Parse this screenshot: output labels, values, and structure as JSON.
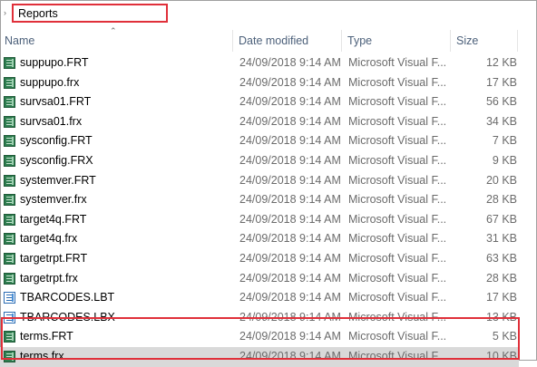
{
  "address": {
    "breadcrumb": "Reports"
  },
  "columns": {
    "name": "Name",
    "date": "Date modified",
    "type": "Type",
    "size": "Size"
  },
  "files": [
    {
      "name": "suppupo.FRT",
      "date": "24/09/2018 9:14 AM",
      "type": "Microsoft Visual F...",
      "size": "12 KB",
      "icon": "green-table-icon"
    },
    {
      "name": "suppupo.frx",
      "date": "24/09/2018 9:14 AM",
      "type": "Microsoft Visual F...",
      "size": "17 KB",
      "icon": "green-table-icon"
    },
    {
      "name": "survsa01.FRT",
      "date": "24/09/2018 9:14 AM",
      "type": "Microsoft Visual F...",
      "size": "56 KB",
      "icon": "green-table-icon"
    },
    {
      "name": "survsa01.frx",
      "date": "24/09/2018 9:14 AM",
      "type": "Microsoft Visual F...",
      "size": "34 KB",
      "icon": "green-table-icon"
    },
    {
      "name": "sysconfig.FRT",
      "date": "24/09/2018 9:14 AM",
      "type": "Microsoft Visual F...",
      "size": "7 KB",
      "icon": "green-table-icon"
    },
    {
      "name": "sysconfig.FRX",
      "date": "24/09/2018 9:14 AM",
      "type": "Microsoft Visual F...",
      "size": "9 KB",
      "icon": "green-table-icon"
    },
    {
      "name": "systemver.FRT",
      "date": "24/09/2018 9:14 AM",
      "type": "Microsoft Visual F...",
      "size": "20 KB",
      "icon": "green-table-icon"
    },
    {
      "name": "systemver.frx",
      "date": "24/09/2018 9:14 AM",
      "type": "Microsoft Visual F...",
      "size": "28 KB",
      "icon": "green-table-icon"
    },
    {
      "name": "target4q.FRT",
      "date": "24/09/2018 9:14 AM",
      "type": "Microsoft Visual F...",
      "size": "67 KB",
      "icon": "green-table-icon"
    },
    {
      "name": "target4q.frx",
      "date": "24/09/2018 9:14 AM",
      "type": "Microsoft Visual F...",
      "size": "31 KB",
      "icon": "green-table-icon"
    },
    {
      "name": "targetrpt.FRT",
      "date": "24/09/2018 9:14 AM",
      "type": "Microsoft Visual F...",
      "size": "63 KB",
      "icon": "green-table-icon"
    },
    {
      "name": "targetrpt.frx",
      "date": "24/09/2018 9:14 AM",
      "type": "Microsoft Visual F...",
      "size": "28 KB",
      "icon": "green-table-icon"
    },
    {
      "name": "TBARCODES.LBT",
      "date": "24/09/2018 9:14 AM",
      "type": "Microsoft Visual F...",
      "size": "17 KB",
      "icon": "blue-table-icon"
    },
    {
      "name": "TBARCODES.LBX",
      "date": "24/09/2018 9:14 AM",
      "type": "Microsoft Visual F...",
      "size": "13 KB",
      "icon": "blue-table-icon"
    },
    {
      "name": "terms.FRT",
      "date": "24/09/2018 9:14 AM",
      "type": "Microsoft Visual F...",
      "size": "5 KB",
      "icon": "green-table-icon"
    },
    {
      "name": "terms.frx",
      "date": "24/09/2018 9:14 AM",
      "type": "Microsoft Visual F...",
      "size": "10 KB",
      "icon": "green-table-icon",
      "selected": true
    }
  ],
  "colors": {
    "highlight": "#e0303a",
    "selection": "#d9d9d9",
    "header_text": "#4c607a"
  }
}
